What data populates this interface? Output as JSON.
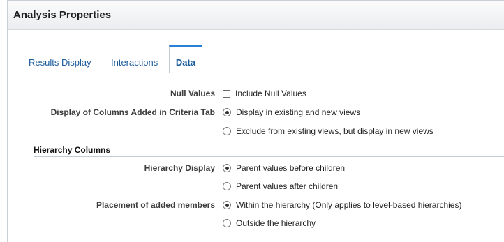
{
  "dialog": {
    "title": "Analysis Properties"
  },
  "tabs": [
    {
      "label": "Results Display",
      "selected": false
    },
    {
      "label": "Interactions",
      "selected": false
    },
    {
      "label": "Data",
      "selected": true
    }
  ],
  "form": {
    "null_values": {
      "label": "Null Values",
      "checkbox_label": "Include Null Values",
      "checked": false
    },
    "display_columns": {
      "label": "Display of Columns Added in Criteria Tab",
      "options": [
        {
          "label": "Display in existing and new views",
          "selected": true
        },
        {
          "label": "Exclude from existing views, but display in new views",
          "selected": false
        }
      ]
    },
    "hierarchy_section": {
      "title": "Hierarchy Columns"
    },
    "hierarchy_display": {
      "label": "Hierarchy Display",
      "options": [
        {
          "label": "Parent values before children",
          "selected": true
        },
        {
          "label": "Parent values after children",
          "selected": false
        }
      ]
    },
    "placement": {
      "label": "Placement of added members",
      "options": [
        {
          "label": "Within the hierarchy (Only applies to level-based hierarchies)",
          "selected": true
        },
        {
          "label": "Outside the hierarchy",
          "selected": false
        }
      ]
    }
  }
}
